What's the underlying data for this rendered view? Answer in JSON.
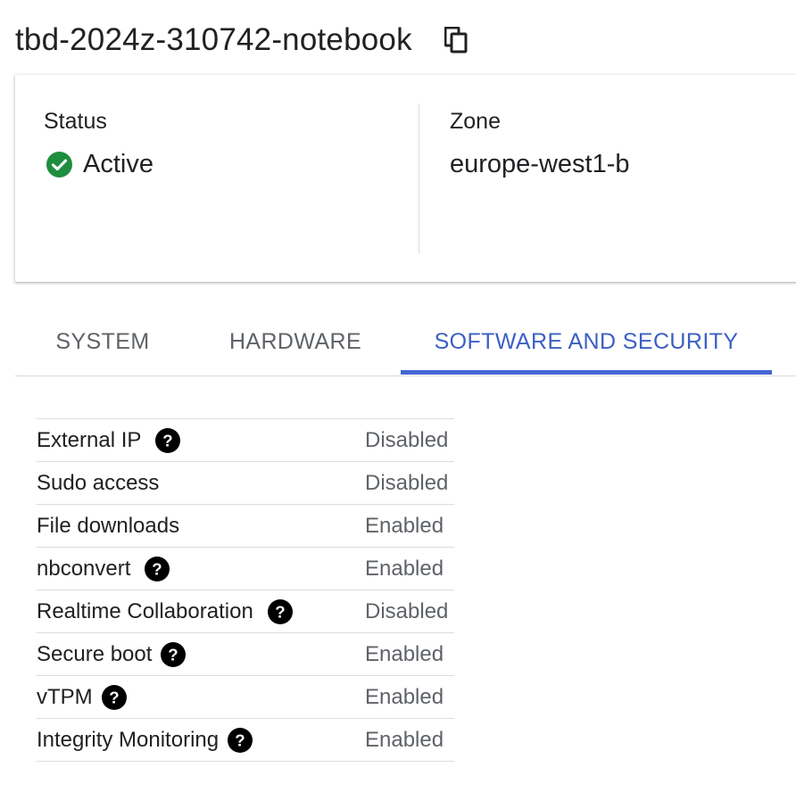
{
  "header": {
    "title": "tbd-2024z-310742-notebook",
    "copy_icon": "copy-icon"
  },
  "summary": {
    "status_label": "Status",
    "status_value": "Active",
    "status_icon": "check-circle-icon",
    "status_color": "#1e8e3e",
    "zone_label": "Zone",
    "zone_value": "europe-west1-b"
  },
  "tabs": [
    {
      "label": "SYSTEM",
      "active": false
    },
    {
      "label": "HARDWARE",
      "active": false
    },
    {
      "label": "SOFTWARE AND SECURITY",
      "active": true
    }
  ],
  "accent_color": "#4466d4",
  "properties": [
    {
      "name": "External IP",
      "help": true,
      "value": "Disabled"
    },
    {
      "name": "Sudo access",
      "help": false,
      "value": "Disabled"
    },
    {
      "name": "File downloads",
      "help": false,
      "value": "Enabled"
    },
    {
      "name": "nbconvert",
      "help": true,
      "value": "Enabled"
    },
    {
      "name": "Realtime Collaboration",
      "help": true,
      "value": "Disabled"
    },
    {
      "name": "Secure boot",
      "help": true,
      "value": "Enabled"
    },
    {
      "name": "vTPM",
      "help": true,
      "value": "Enabled"
    },
    {
      "name": "Integrity Monitoring",
      "help": true,
      "value": "Enabled"
    }
  ]
}
